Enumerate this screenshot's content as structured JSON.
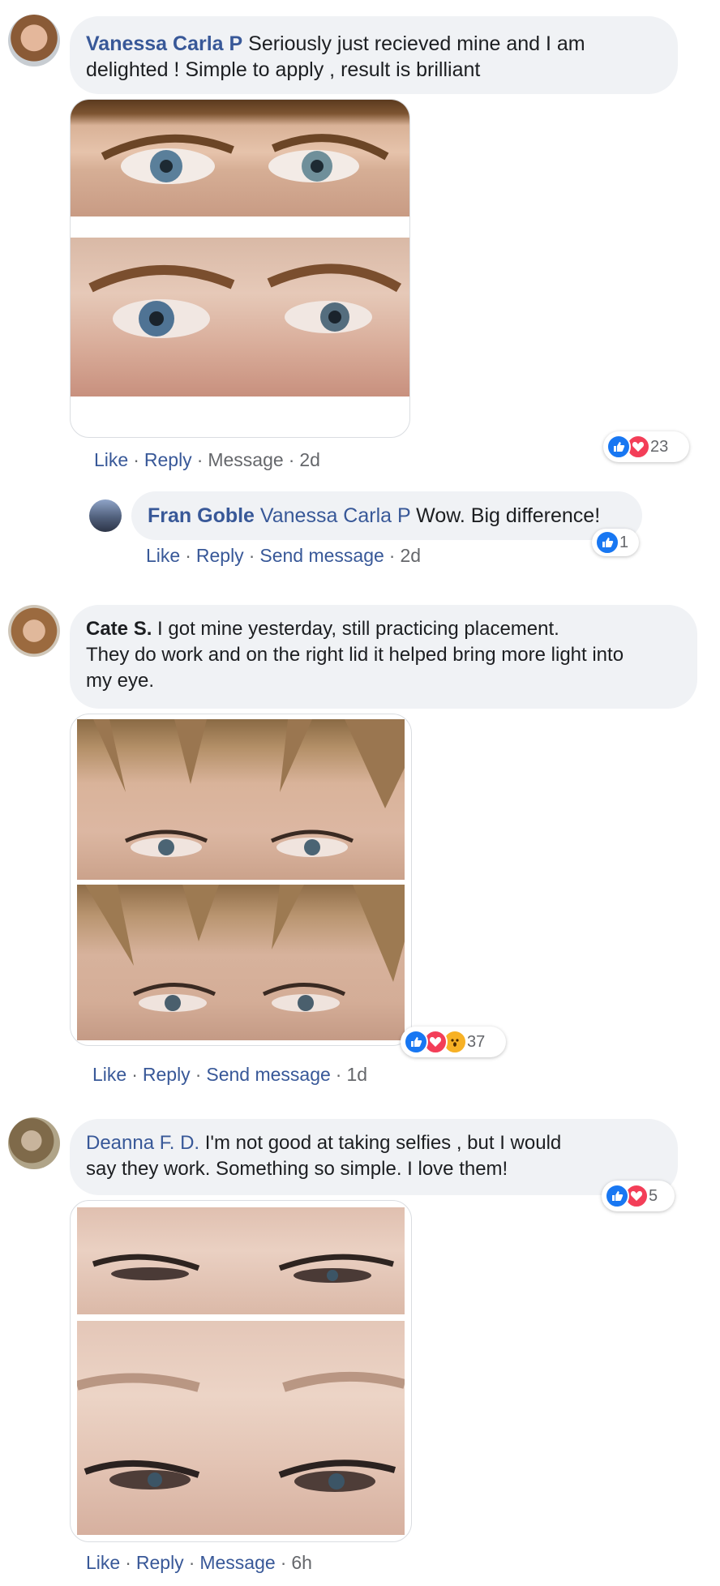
{
  "comments": [
    {
      "author": "Vanessa Carla P",
      "text_line1": "Seriously just recieved mine and I am",
      "text_line2": "delighted ! Simple to apply , result is brilliant",
      "action_like": "Like",
      "action_reply": "Reply",
      "action_message": "Message",
      "time": "2d",
      "reaction_count": "23"
    },
    {
      "author": "Fran Goble",
      "mention": "Vanessa Carla P",
      "text": "Wow. Big difference!",
      "action_like": "Like",
      "action_reply": "Reply",
      "action_message": "Send message",
      "time": "2d",
      "reaction_count": "1"
    },
    {
      "author": "Cate S.",
      "text_line1": "I got mine yesterday, still practicing placement.",
      "text_line2": "They do work and on the right lid it helped bring more light into",
      "text_line3": "my eye.",
      "action_like": "Like",
      "action_reply": "Reply",
      "action_message": "Send message",
      "time": "1d",
      "reaction_count": "37"
    },
    {
      "author": "Deanna F. D.",
      "text_line1": "I'm not good at taking selfies , but I would",
      "text_line2": "say they work. Something so simple. I love them!",
      "action_like": "Like",
      "action_reply": "Reply",
      "action_message": "Message",
      "time": "6h",
      "reaction_count": "5"
    }
  ],
  "colors": {
    "link": "#385898",
    "bubble": "#f0f2f5",
    "like": "#1877f2",
    "love": "#f33e58",
    "wow": "#f7b125"
  },
  "icons": [
    "like-reaction-icon",
    "love-reaction-icon",
    "wow-reaction-icon"
  ]
}
